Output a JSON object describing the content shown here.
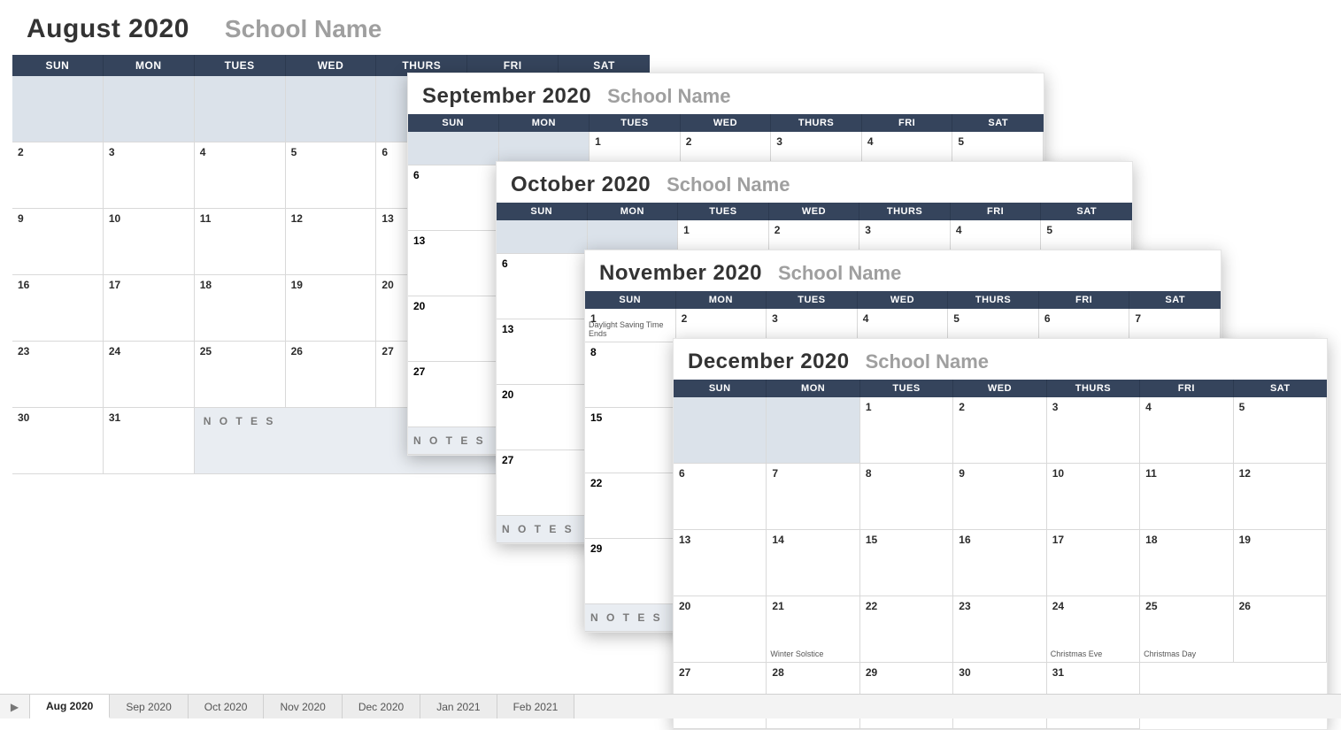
{
  "school_name": "School Name",
  "dow": [
    "SUN",
    "MON",
    "TUES",
    "WED",
    "THURS",
    "FRI",
    "SAT"
  ],
  "notes_label": "N O T E S",
  "months": {
    "aug": {
      "title": "August 2020",
      "lead_blanks": 6,
      "days": 31
    },
    "sep": {
      "title": "September 2020",
      "first_row": [
        "",
        "1",
        "2",
        "3",
        "4",
        "5"
      ],
      "sun_col": [
        "",
        "6",
        "13",
        "20",
        "27"
      ]
    },
    "oct": {
      "title": "October 2020",
      "first_row": [
        "",
        "",
        "1",
        "2",
        "3",
        "4",
        "5"
      ],
      "sun_col": [
        "",
        "6",
        "13",
        "20",
        "27"
      ]
    },
    "nov": {
      "title": "November 2020",
      "first_row": [
        "1",
        "2",
        "3",
        "4",
        "5",
        "6",
        "7"
      ],
      "sun_col": [
        "1",
        "8",
        "15",
        "22",
        "29"
      ],
      "events": {
        "1": "Daylight Saving Time Ends"
      }
    },
    "dec": {
      "title": "December 2020",
      "lead_blanks": 2,
      "days": 31,
      "events": {
        "21": "Winter Solstice",
        "24": "Christmas Eve",
        "25": "Christmas Day"
      }
    }
  },
  "tabs": [
    "Aug 2020",
    "Sep 2020",
    "Oct 2020",
    "Nov 2020",
    "Dec 2020",
    "Jan 2021",
    "Feb 2021"
  ],
  "active_tab": 0
}
